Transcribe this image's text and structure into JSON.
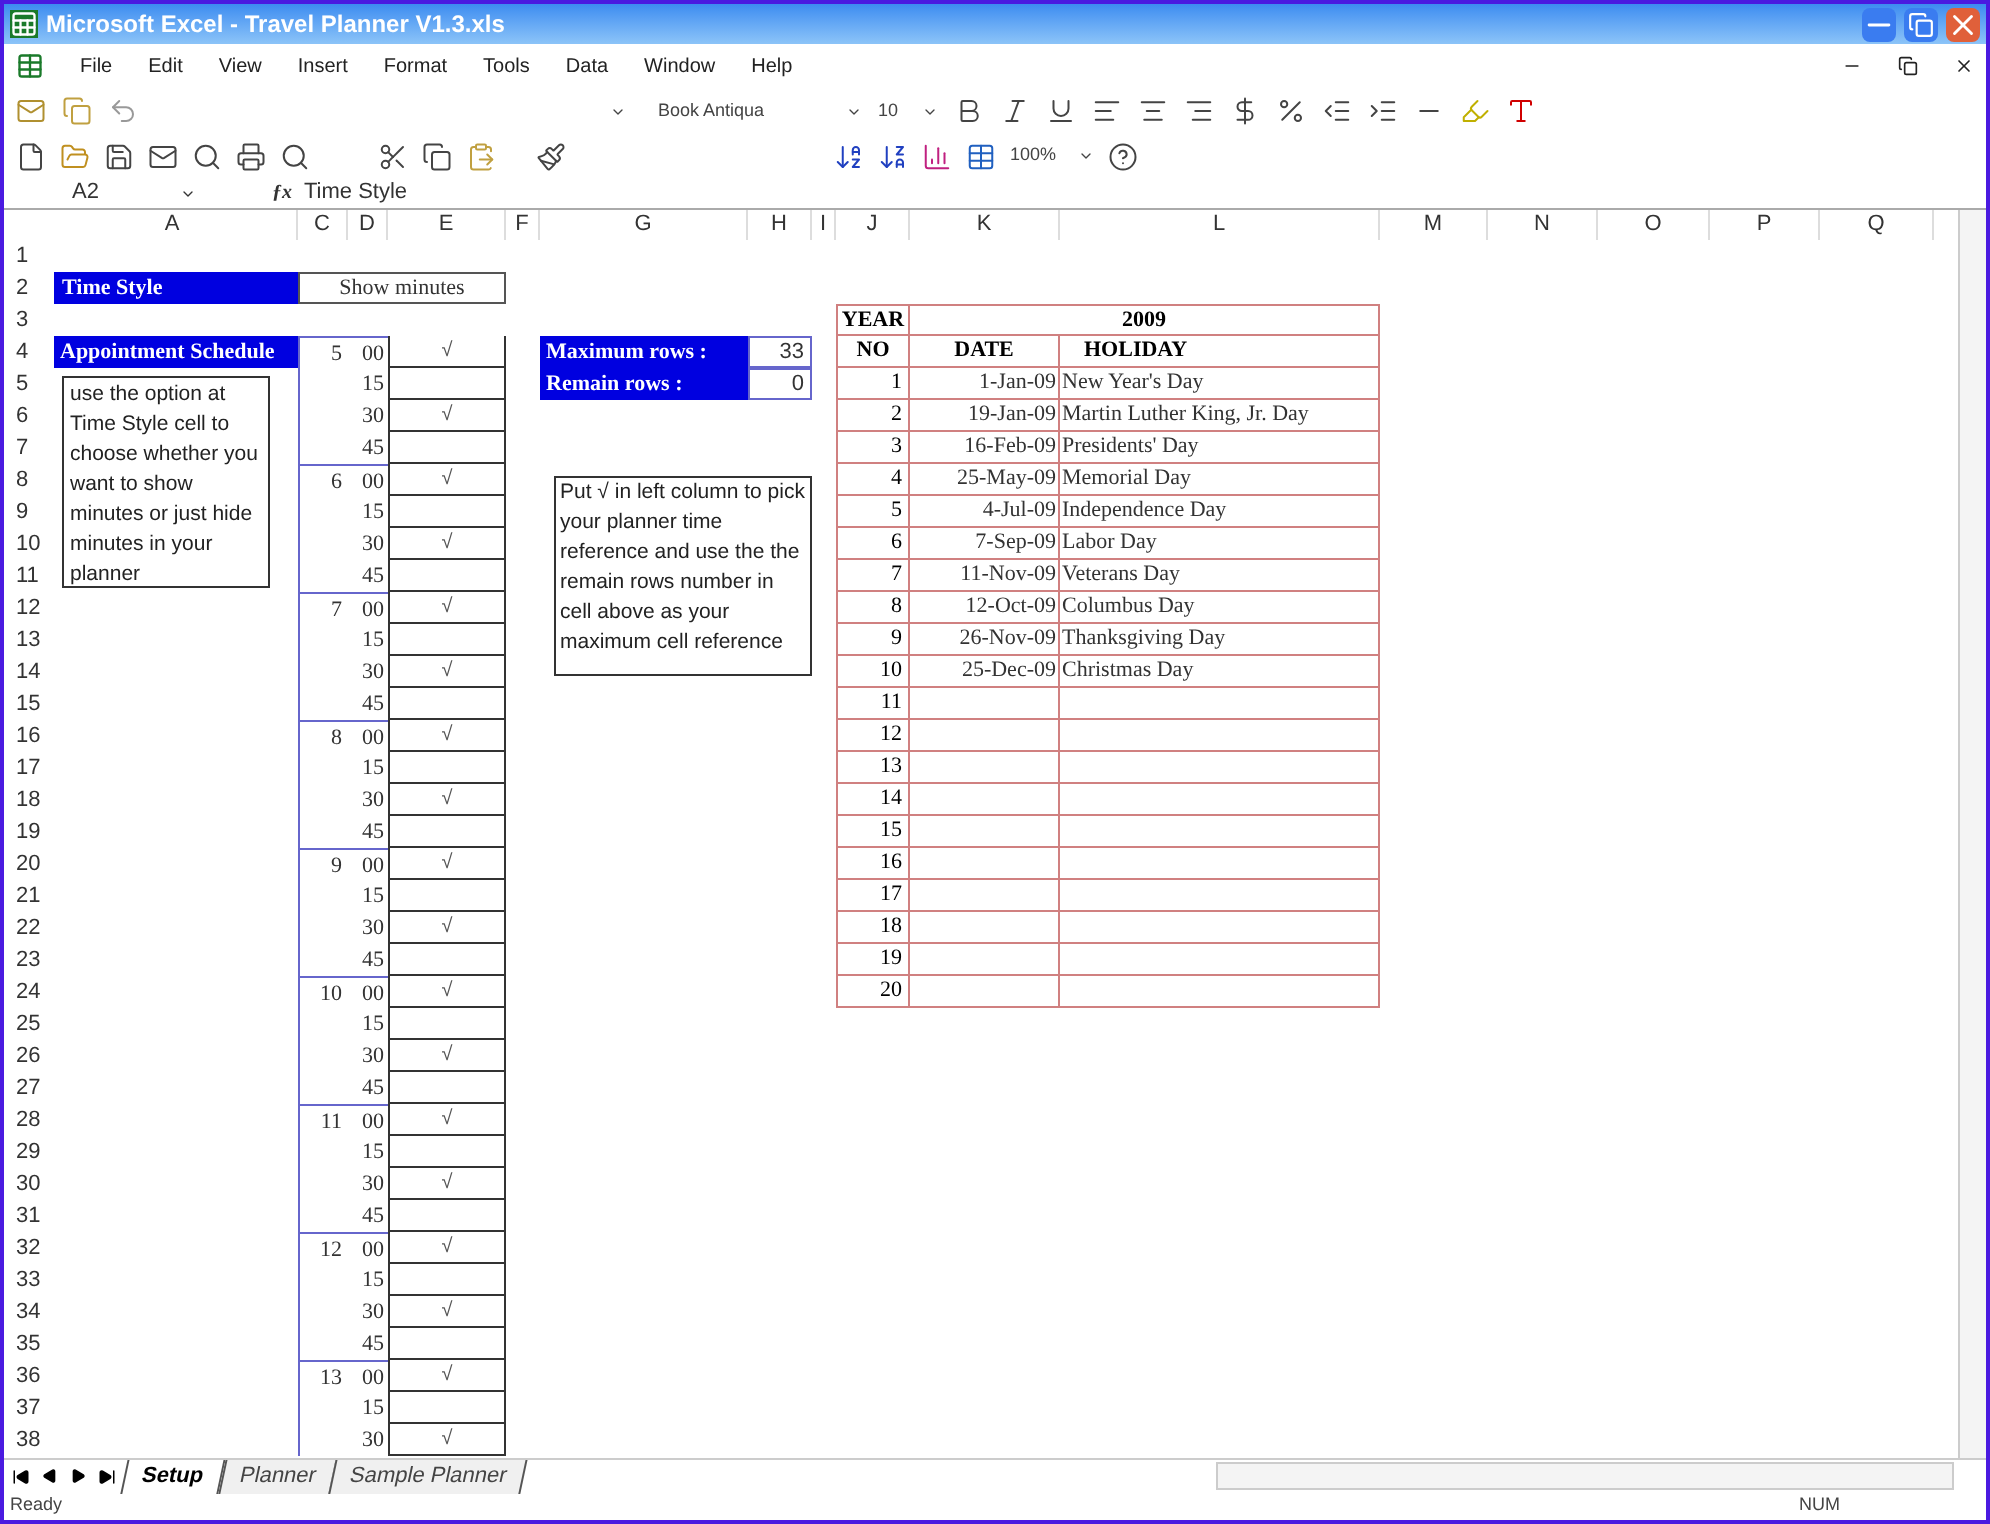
{
  "window": {
    "title": "Microsoft Excel - Travel Planner V1.3.xls"
  },
  "menu": [
    "File",
    "Edit",
    "View",
    "Insert",
    "Format",
    "Tools",
    "Data",
    "Window",
    "Help"
  ],
  "formatting_toolbar": {
    "font": "Book Antiqua",
    "size": "10"
  },
  "standard_toolbar": {
    "zoom": "100%"
  },
  "formula_bar": {
    "name_box": "A2",
    "function_label": "ƒx",
    "formula": "Time Style"
  },
  "column_headers": [
    "A",
    "C",
    "D",
    "E",
    "F",
    "G",
    "H",
    "I",
    "J",
    "K",
    "L",
    "M",
    "N",
    "O",
    "P",
    "Q"
  ],
  "row_numbers": [
    "1",
    "2",
    "3",
    "4",
    "5",
    "6",
    "7",
    "8",
    "9",
    "10",
    "11",
    "12",
    "13",
    "14",
    "15",
    "16",
    "17",
    "18",
    "19",
    "20",
    "21",
    "22",
    "23",
    "24",
    "25",
    "26",
    "27",
    "28",
    "29",
    "30",
    "31",
    "32",
    "33",
    "34",
    "35",
    "36",
    "37",
    "38"
  ],
  "time_style": {
    "label": "Time Style",
    "value": "Show minutes"
  },
  "appointment_schedule": {
    "label": "Appointment Schedule",
    "hours": [
      {
        "hour": "5",
        "slots": [
          {
            "minute": "00",
            "mark": "√"
          },
          {
            "minute": "15"
          },
          {
            "minute": "30",
            "mark": "√"
          },
          {
            "minute": "45"
          }
        ]
      },
      {
        "hour": "6",
        "slots": [
          {
            "minute": "00",
            "mark": "√"
          },
          {
            "minute": "15"
          },
          {
            "minute": "30",
            "mark": "√"
          },
          {
            "minute": "45"
          }
        ]
      },
      {
        "hour": "7",
        "slots": [
          {
            "minute": "00",
            "mark": "√"
          },
          {
            "minute": "15"
          },
          {
            "minute": "30",
            "mark": "√"
          },
          {
            "minute": "45"
          }
        ]
      },
      {
        "hour": "8",
        "slots": [
          {
            "minute": "00",
            "mark": "√"
          },
          {
            "minute": "15"
          },
          {
            "minute": "30",
            "mark": "√"
          },
          {
            "minute": "45"
          }
        ]
      },
      {
        "hour": "9",
        "slots": [
          {
            "minute": "00",
            "mark": "√"
          },
          {
            "minute": "15"
          },
          {
            "minute": "30",
            "mark": "√"
          },
          {
            "minute": "45"
          }
        ]
      },
      {
        "hour": "10",
        "slots": [
          {
            "minute": "00",
            "mark": "√"
          },
          {
            "minute": "15"
          },
          {
            "minute": "30",
            "mark": "√"
          },
          {
            "minute": "45"
          }
        ]
      },
      {
        "hour": "11",
        "slots": [
          {
            "minute": "00",
            "mark": "√"
          },
          {
            "minute": "15"
          },
          {
            "minute": "30",
            "mark": "√"
          },
          {
            "minute": "45"
          }
        ]
      },
      {
        "hour": "12",
        "slots": [
          {
            "minute": "00",
            "mark": "√"
          },
          {
            "minute": "15"
          },
          {
            "minute": "30",
            "mark": "√"
          },
          {
            "minute": "45"
          }
        ]
      },
      {
        "hour": "13",
        "slots": [
          {
            "minute": "00",
            "mark": "√"
          },
          {
            "minute": "15"
          },
          {
            "minute": "30",
            "mark": "√"
          }
        ]
      }
    ]
  },
  "time_style_note": "use the option at Time Style cell to choose whether you want to show minutes or just hide minutes in your planner",
  "row_counts": [
    {
      "label": "Maximum rows :",
      "value": "33"
    },
    {
      "label": "Remain rows :",
      "value": "0"
    }
  ],
  "reference_note": "Put √ in left column to pick your planner time reference  and use the the remain rows number in cell above as your maximum cell reference",
  "holiday_table": {
    "year_label": "YEAR",
    "year": "2009",
    "columns": [
      "NO",
      "DATE",
      "HOLIDAY"
    ],
    "rows": [
      {
        "no": "1",
        "date": "1-Jan-09",
        "holiday": "New Year's Day"
      },
      {
        "no": "2",
        "date": "19-Jan-09",
        "holiday": "Martin Luther King, Jr. Day"
      },
      {
        "no": "3",
        "date": "16-Feb-09",
        "holiday": "Presidents' Day"
      },
      {
        "no": "4",
        "date": "25-May-09",
        "holiday": "Memorial Day"
      },
      {
        "no": "5",
        "date": "4-Jul-09",
        "holiday": "Independence Day"
      },
      {
        "no": "6",
        "date": "7-Sep-09",
        "holiday": "Labor Day"
      },
      {
        "no": "7",
        "date": "11-Nov-09",
        "holiday": "Veterans Day"
      },
      {
        "no": "8",
        "date": "12-Oct-09",
        "holiday": "Columbus Day"
      },
      {
        "no": "9",
        "date": "26-Nov-09",
        "holiday": "Thanksgiving Day"
      },
      {
        "no": "10",
        "date": "25-Dec-09",
        "holiday": "Christmas Day"
      },
      {
        "no": "11"
      },
      {
        "no": "12"
      },
      {
        "no": "13"
      },
      {
        "no": "14"
      },
      {
        "no": "15"
      },
      {
        "no": "16"
      },
      {
        "no": "17"
      },
      {
        "no": "18"
      },
      {
        "no": "19"
      },
      {
        "no": "20"
      }
    ]
  },
  "sheet_tabs": [
    {
      "label": "Setup",
      "selected": true
    },
    {
      "label": "Planner",
      "selected": false
    },
    {
      "label": "Sample Planner",
      "selected": false
    }
  ],
  "status_bar": {
    "status": "Ready",
    "indicator": "NUM"
  }
}
